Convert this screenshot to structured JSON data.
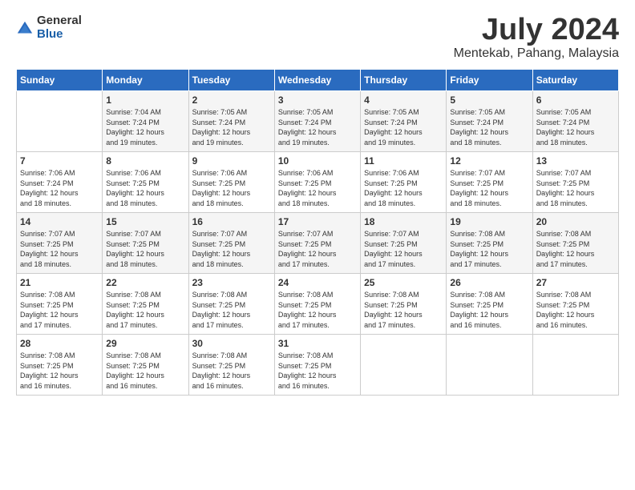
{
  "logo": {
    "general": "General",
    "blue": "Blue"
  },
  "header": {
    "month": "July 2024",
    "location": "Mentekab, Pahang, Malaysia"
  },
  "weekdays": [
    "Sunday",
    "Monday",
    "Tuesday",
    "Wednesday",
    "Thursday",
    "Friday",
    "Saturday"
  ],
  "weeks": [
    [
      {
        "day": "",
        "sunrise": "",
        "sunset": "",
        "daylight": ""
      },
      {
        "day": "1",
        "sunrise": "Sunrise: 7:04 AM",
        "sunset": "Sunset: 7:24 PM",
        "daylight": "Daylight: 12 hours and 19 minutes."
      },
      {
        "day": "2",
        "sunrise": "Sunrise: 7:05 AM",
        "sunset": "Sunset: 7:24 PM",
        "daylight": "Daylight: 12 hours and 19 minutes."
      },
      {
        "day": "3",
        "sunrise": "Sunrise: 7:05 AM",
        "sunset": "Sunset: 7:24 PM",
        "daylight": "Daylight: 12 hours and 19 minutes."
      },
      {
        "day": "4",
        "sunrise": "Sunrise: 7:05 AM",
        "sunset": "Sunset: 7:24 PM",
        "daylight": "Daylight: 12 hours and 19 minutes."
      },
      {
        "day": "5",
        "sunrise": "Sunrise: 7:05 AM",
        "sunset": "Sunset: 7:24 PM",
        "daylight": "Daylight: 12 hours and 18 minutes."
      },
      {
        "day": "6",
        "sunrise": "Sunrise: 7:05 AM",
        "sunset": "Sunset: 7:24 PM",
        "daylight": "Daylight: 12 hours and 18 minutes."
      }
    ],
    [
      {
        "day": "7",
        "sunrise": "Sunrise: 7:06 AM",
        "sunset": "Sunset: 7:24 PM",
        "daylight": "Daylight: 12 hours and 18 minutes."
      },
      {
        "day": "8",
        "sunrise": "Sunrise: 7:06 AM",
        "sunset": "Sunset: 7:25 PM",
        "daylight": "Daylight: 12 hours and 18 minutes."
      },
      {
        "day": "9",
        "sunrise": "Sunrise: 7:06 AM",
        "sunset": "Sunset: 7:25 PM",
        "daylight": "Daylight: 12 hours and 18 minutes."
      },
      {
        "day": "10",
        "sunrise": "Sunrise: 7:06 AM",
        "sunset": "Sunset: 7:25 PM",
        "daylight": "Daylight: 12 hours and 18 minutes."
      },
      {
        "day": "11",
        "sunrise": "Sunrise: 7:06 AM",
        "sunset": "Sunset: 7:25 PM",
        "daylight": "Daylight: 12 hours and 18 minutes."
      },
      {
        "day": "12",
        "sunrise": "Sunrise: 7:07 AM",
        "sunset": "Sunset: 7:25 PM",
        "daylight": "Daylight: 12 hours and 18 minutes."
      },
      {
        "day": "13",
        "sunrise": "Sunrise: 7:07 AM",
        "sunset": "Sunset: 7:25 PM",
        "daylight": "Daylight: 12 hours and 18 minutes."
      }
    ],
    [
      {
        "day": "14",
        "sunrise": "Sunrise: 7:07 AM",
        "sunset": "Sunset: 7:25 PM",
        "daylight": "Daylight: 12 hours and 18 minutes."
      },
      {
        "day": "15",
        "sunrise": "Sunrise: 7:07 AM",
        "sunset": "Sunset: 7:25 PM",
        "daylight": "Daylight: 12 hours and 18 minutes."
      },
      {
        "day": "16",
        "sunrise": "Sunrise: 7:07 AM",
        "sunset": "Sunset: 7:25 PM",
        "daylight": "Daylight: 12 hours and 18 minutes."
      },
      {
        "day": "17",
        "sunrise": "Sunrise: 7:07 AM",
        "sunset": "Sunset: 7:25 PM",
        "daylight": "Daylight: 12 hours and 17 minutes."
      },
      {
        "day": "18",
        "sunrise": "Sunrise: 7:07 AM",
        "sunset": "Sunset: 7:25 PM",
        "daylight": "Daylight: 12 hours and 17 minutes."
      },
      {
        "day": "19",
        "sunrise": "Sunrise: 7:08 AM",
        "sunset": "Sunset: 7:25 PM",
        "daylight": "Daylight: 12 hours and 17 minutes."
      },
      {
        "day": "20",
        "sunrise": "Sunrise: 7:08 AM",
        "sunset": "Sunset: 7:25 PM",
        "daylight": "Daylight: 12 hours and 17 minutes."
      }
    ],
    [
      {
        "day": "21",
        "sunrise": "Sunrise: 7:08 AM",
        "sunset": "Sunset: 7:25 PM",
        "daylight": "Daylight: 12 hours and 17 minutes."
      },
      {
        "day": "22",
        "sunrise": "Sunrise: 7:08 AM",
        "sunset": "Sunset: 7:25 PM",
        "daylight": "Daylight: 12 hours and 17 minutes."
      },
      {
        "day": "23",
        "sunrise": "Sunrise: 7:08 AM",
        "sunset": "Sunset: 7:25 PM",
        "daylight": "Daylight: 12 hours and 17 minutes."
      },
      {
        "day": "24",
        "sunrise": "Sunrise: 7:08 AM",
        "sunset": "Sunset: 7:25 PM",
        "daylight": "Daylight: 12 hours and 17 minutes."
      },
      {
        "day": "25",
        "sunrise": "Sunrise: 7:08 AM",
        "sunset": "Sunset: 7:25 PM",
        "daylight": "Daylight: 12 hours and 17 minutes."
      },
      {
        "day": "26",
        "sunrise": "Sunrise: 7:08 AM",
        "sunset": "Sunset: 7:25 PM",
        "daylight": "Daylight: 12 hours and 16 minutes."
      },
      {
        "day": "27",
        "sunrise": "Sunrise: 7:08 AM",
        "sunset": "Sunset: 7:25 PM",
        "daylight": "Daylight: 12 hours and 16 minutes."
      }
    ],
    [
      {
        "day": "28",
        "sunrise": "Sunrise: 7:08 AM",
        "sunset": "Sunset: 7:25 PM",
        "daylight": "Daylight: 12 hours and 16 minutes."
      },
      {
        "day": "29",
        "sunrise": "Sunrise: 7:08 AM",
        "sunset": "Sunset: 7:25 PM",
        "daylight": "Daylight: 12 hours and 16 minutes."
      },
      {
        "day": "30",
        "sunrise": "Sunrise: 7:08 AM",
        "sunset": "Sunset: 7:25 PM",
        "daylight": "Daylight: 12 hours and 16 minutes."
      },
      {
        "day": "31",
        "sunrise": "Sunrise: 7:08 AM",
        "sunset": "Sunset: 7:25 PM",
        "daylight": "Daylight: 12 hours and 16 minutes."
      },
      {
        "day": "",
        "sunrise": "",
        "sunset": "",
        "daylight": ""
      },
      {
        "day": "",
        "sunrise": "",
        "sunset": "",
        "daylight": ""
      },
      {
        "day": "",
        "sunrise": "",
        "sunset": "",
        "daylight": ""
      }
    ]
  ]
}
